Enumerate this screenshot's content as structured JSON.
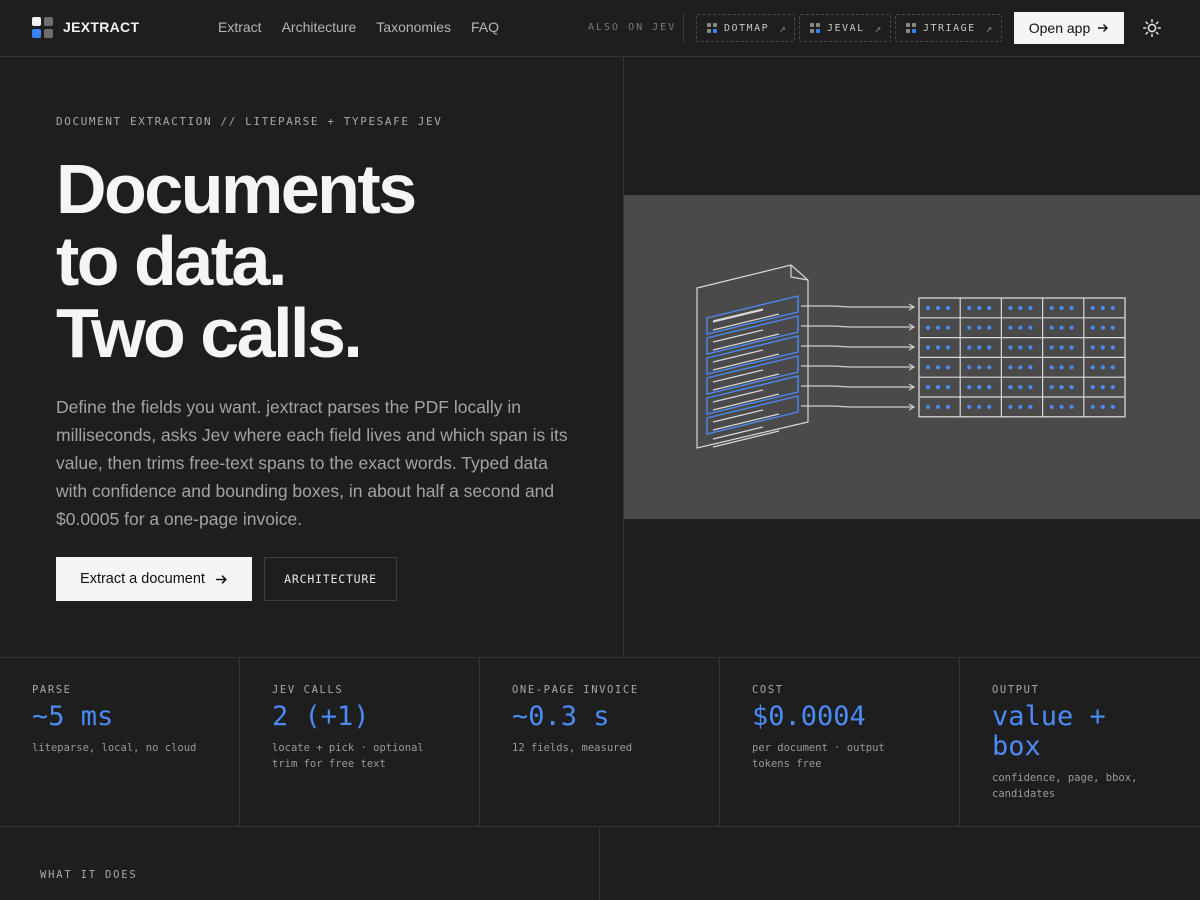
{
  "nav": {
    "brand": "JEXTRACT",
    "links": [
      "Extract",
      "Architecture",
      "Taxonomies",
      "FAQ"
    ],
    "also_label": "ALSO ON JEV",
    "sister_apps": [
      {
        "label": "DOTMAP",
        "icon": "external-arrow-icon"
      },
      {
        "label": "JEVAL",
        "icon": "external-arrow-icon"
      },
      {
        "label": "JTRIAGE",
        "icon": "external-arrow-icon"
      }
    ],
    "open_app_label": "Open app",
    "theme_toggle_icon": "sun-icon"
  },
  "hero": {
    "eyebrow": "DOCUMENT EXTRACTION // LITEPARSE + TYPESAFE JEV",
    "headline": [
      "Documents",
      "to data.",
      "Two calls."
    ],
    "lede": "Define the fields you want. jextract parses the PDF locally in milliseconds, asks Jev where each field lives and which span is its value, then trims free-text spans to the exact words. Typed data with confidence and bounding boxes, in about half a second and $0.0005 for a one-page invoice.",
    "primary_cta": "Extract a document",
    "secondary_cta": "ARCHITECTURE",
    "illustration": "document-to-table-illustration"
  },
  "stats": [
    {
      "label": "PARSE",
      "value": "~5 ms",
      "sub": "liteparse, local, no cloud"
    },
    {
      "label": "JEV CALLS",
      "value": "2 (+1)",
      "sub": "locate + pick · optional trim for free text"
    },
    {
      "label": "ONE-PAGE INVOICE",
      "value": "~0.3 s",
      "sub": "12 fields, measured"
    },
    {
      "label": "COST",
      "value": "$0.0004",
      "sub": "per document · output tokens free"
    },
    {
      "label": "OUTPUT",
      "value": "value + box",
      "sub": "confidence, page, bbox, candidates"
    }
  ],
  "sections": {
    "what_it_does_label": "WHAT IT DOES"
  },
  "colors": {
    "accent": "#4a8bf5",
    "background": "#1e1e1e",
    "illustration_panel": "#4a4a4a"
  }
}
